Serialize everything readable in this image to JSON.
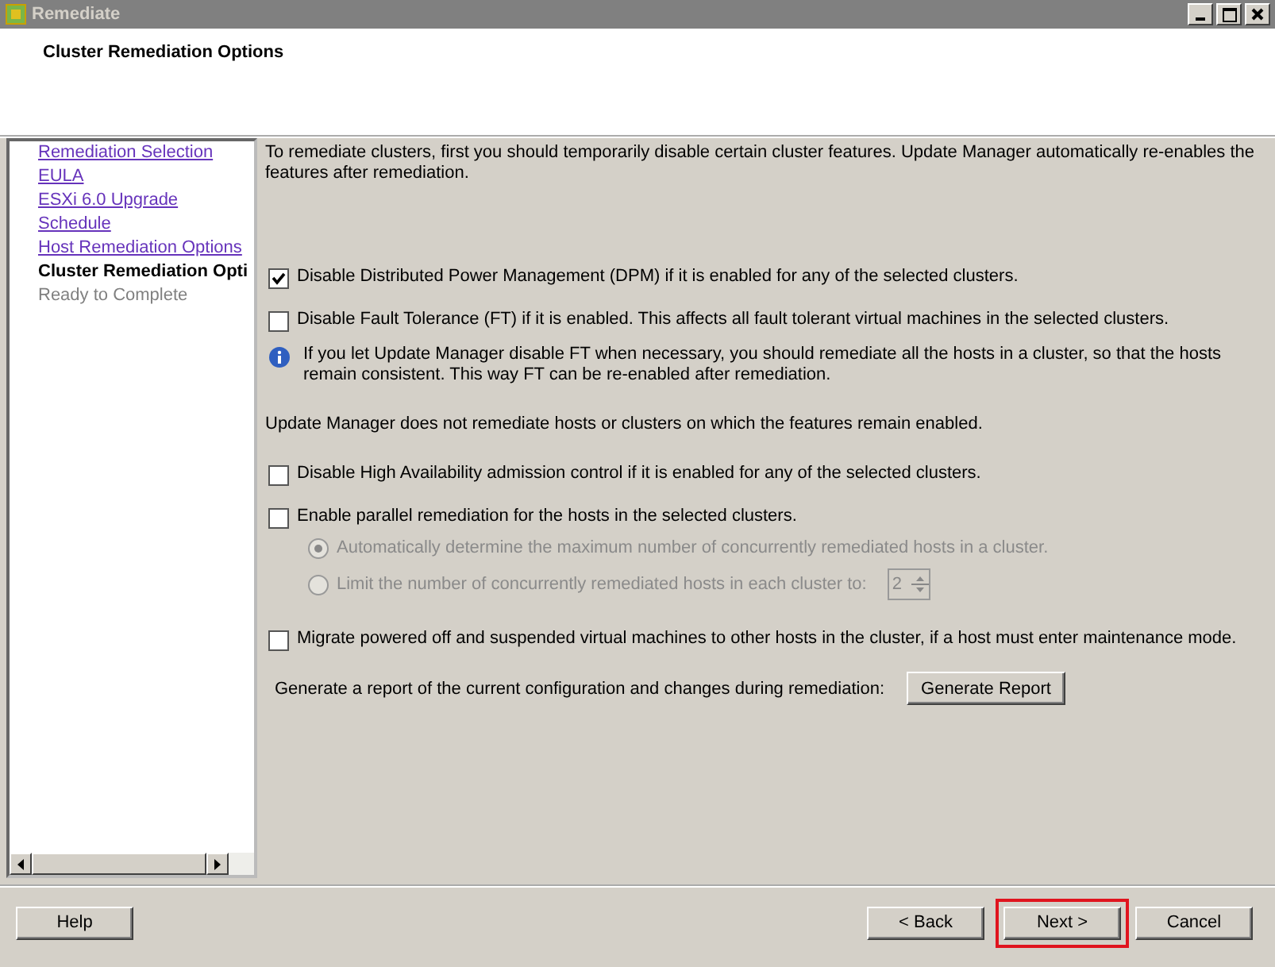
{
  "window": {
    "title": "Remediate"
  },
  "header": {
    "title": "Cluster Remediation Options"
  },
  "sidebar": {
    "items": [
      {
        "label": "Remediation Selection",
        "kind": "link"
      },
      {
        "label": "EULA",
        "kind": "link"
      },
      {
        "label": "ESXi 6.0 Upgrade",
        "kind": "link"
      },
      {
        "label": "Schedule",
        "kind": "link"
      },
      {
        "label": "Host Remediation Options",
        "kind": "link"
      },
      {
        "label": "Cluster Remediation Opti",
        "kind": "current"
      },
      {
        "label": "Ready to Complete",
        "kind": "pending"
      }
    ]
  },
  "content": {
    "intro": "To remediate clusters, first you should temporarily disable certain cluster features. Update Manager automatically re-enables the features after remediation.",
    "options": [
      {
        "kind": "checkbox",
        "label": "Disable Distributed Power Management (DPM) if it is enabled for any of the selected clusters.",
        "checked": true
      },
      {
        "kind": "checkbox",
        "label": "Disable Fault Tolerance (FT) if it is enabled. This affects all fault tolerant virtual machines in the selected clusters.",
        "checked": false
      },
      {
        "kind": "info",
        "label": "If you let Update Manager disable FT when necessary, you should remediate all the hosts in a cluster, so that the hosts remain consistent. This way FT can be re-enabled after remediation."
      },
      {
        "kind": "note",
        "label": "Update Manager does not remediate hosts or clusters on which the features remain enabled."
      },
      {
        "kind": "checkbox",
        "label": "Disable High Availability admission control if it is enabled for any of the selected clusters.",
        "checked": false
      },
      {
        "kind": "checkbox",
        "label": "Enable parallel remediation for the hosts in the selected clusters.",
        "checked": false
      },
      {
        "kind": "radio",
        "label": "Automatically determine the maximum number of concurrently remediated hosts in a cluster.",
        "selected": true,
        "disabled": true
      },
      {
        "kind": "radio",
        "label": "Limit the number of concurrently remediated hosts in each cluster to:",
        "selected": false,
        "disabled": true,
        "spinner": "2"
      },
      {
        "kind": "checkbox",
        "label": "Migrate powered off and suspended virtual machines to other hosts in the cluster, if a host must enter maintenance mode.",
        "checked": false
      }
    ],
    "report": {
      "label": "Generate a report of the current configuration and changes during remediation:",
      "button": "Generate Report"
    }
  },
  "footer": {
    "help": "Help",
    "buttons": [
      {
        "label": "< Back",
        "highlighted": false
      },
      {
        "label": "Next >",
        "highlighted": true
      },
      {
        "label": "Cancel",
        "highlighted": false
      }
    ]
  }
}
